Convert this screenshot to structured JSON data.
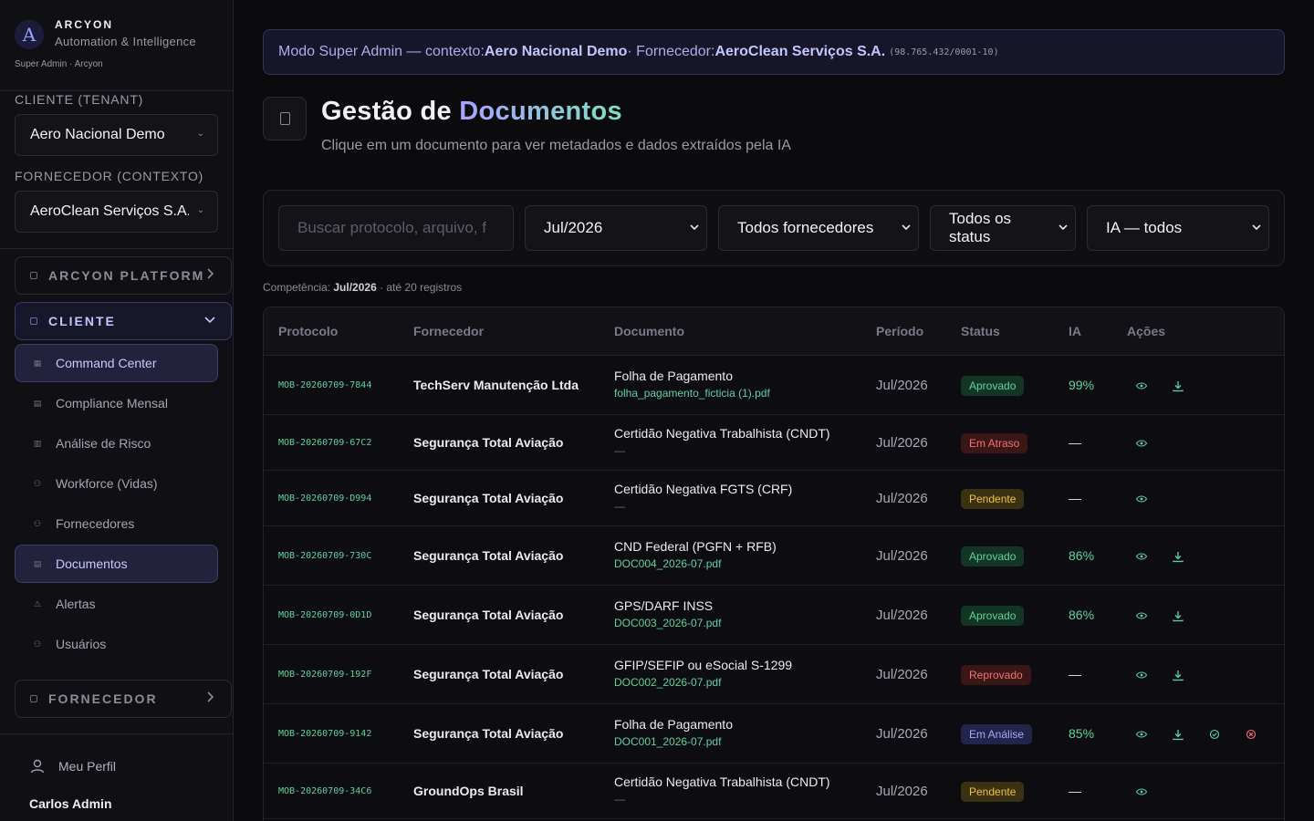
{
  "brand": {
    "name": "ARCYON",
    "tagline": "Automation & Intelligence",
    "subtitle": "Super Admin · Arcyon",
    "logo_letter": "A"
  },
  "sidebar": {
    "tenant_label": "CLIENTE (TENANT)",
    "tenant_value": "Aero Nacional Demo",
    "supplier_label": "FORNECEDOR (CONTEXTO)",
    "supplier_value": "AeroClean Serviços S.A.",
    "sections": {
      "platform": "ARCYON PLATFORM",
      "client": "CLIENTE",
      "supplier": "FORNECEDOR"
    },
    "items": [
      {
        "label": "Command Center",
        "icon": "grid-icon"
      },
      {
        "label": "Compliance Mensal",
        "icon": "document-icon"
      },
      {
        "label": "Análise de Risco",
        "icon": "bar-chart-icon"
      },
      {
        "label": "Workforce (Vidas)",
        "icon": "users-icon"
      },
      {
        "label": "Fornecedores",
        "icon": "users-icon"
      },
      {
        "label": "Documentos",
        "icon": "document-icon"
      },
      {
        "label": "Alertas",
        "icon": "warning-icon"
      },
      {
        "label": "Usuários",
        "icon": "users-icon"
      }
    ],
    "profile_label": "Meu Perfil",
    "user_name": "Carlos Admin"
  },
  "banner": {
    "prefix": "Modo Super Admin — contexto: ",
    "context": "Aero Nacional Demo",
    "mid": " · Fornecedor: ",
    "supplier": "AeroClean Serviços S.A.",
    "cnpj": "(98.765.432/0001-10)"
  },
  "page": {
    "title_main": "Gestão de ",
    "title_accent": "Documentos",
    "subtitle": "Clique em um documento para ver metadados e dados extraídos pela IA"
  },
  "filters": {
    "search_placeholder": "Buscar protocolo, arquivo, f",
    "period": "Jul/2026",
    "suppliers": "Todos fornecedores",
    "status": "Todos os status",
    "ia": "IA — todos"
  },
  "summary": {
    "prefix": "Competência: ",
    "period": "Jul/2026",
    "suffix": " · até 20 registros"
  },
  "table": {
    "headers": {
      "protocolo": "Protocolo",
      "fornecedor": "Fornecedor",
      "documento": "Documento",
      "periodo": "Período",
      "status": "Status",
      "ia": "IA",
      "acoes": "Ações"
    },
    "rows": [
      {
        "protocolo": "MOB-20260709-7844",
        "fornecedor": "TechServ Manutenção Ltda",
        "documento": "Folha de Pagamento",
        "arquivo": "folha_pagamento_ficticia (1).pdf",
        "periodo": "Jul/2026",
        "status": "Aprovado",
        "ia": "99%"
      },
      {
        "protocolo": "MOB-20260709-67C2",
        "fornecedor": "Segurança Total Aviação",
        "documento": "Certidão Negativa Trabalhista (CNDT)",
        "arquivo": "—",
        "periodo": "Jul/2026",
        "status": "Em Atraso",
        "ia": "—"
      },
      {
        "protocolo": "MOB-20260709-D994",
        "fornecedor": "Segurança Total Aviação",
        "documento": "Certidão Negativa FGTS (CRF)",
        "arquivo": "—",
        "periodo": "Jul/2026",
        "status": "Pendente",
        "ia": "—"
      },
      {
        "protocolo": "MOB-20260709-730C",
        "fornecedor": "Segurança Total Aviação",
        "documento": "CND Federal (PGFN + RFB)",
        "arquivo": "DOC004_2026-07.pdf",
        "periodo": "Jul/2026",
        "status": "Aprovado",
        "ia": "86%"
      },
      {
        "protocolo": "MOB-20260709-0D1D",
        "fornecedor": "Segurança Total Aviação",
        "documento": "GPS/DARF INSS",
        "arquivo": "DOC003_2026-07.pdf",
        "periodo": "Jul/2026",
        "status": "Aprovado",
        "ia": "86%"
      },
      {
        "protocolo": "MOB-20260709-192F",
        "fornecedor": "Segurança Total Aviação",
        "documento": "GFIP/SEFIP ou eSocial S-1299",
        "arquivo": "DOC002_2026-07.pdf",
        "periodo": "Jul/2026",
        "status": "Reprovado",
        "ia": "—"
      },
      {
        "protocolo": "MOB-20260709-9142",
        "fornecedor": "Segurança Total Aviação",
        "documento": "Folha de Pagamento",
        "arquivo": "DOC001_2026-07.pdf",
        "periodo": "Jul/2026",
        "status": "Em Análise",
        "ia": "85%"
      },
      {
        "protocolo": "MOB-20260709-34C6",
        "fornecedor": "GroundOps Brasil",
        "documento": "Certidão Negativa Trabalhista (CNDT)",
        "arquivo": "—",
        "periodo": "Jul/2026",
        "status": "Pendente",
        "ia": "—"
      }
    ]
  },
  "colors": {
    "accent": "#a8a2ff",
    "success": "#5fd3a0",
    "danger": "#f07272",
    "warning": "#f0c040"
  }
}
